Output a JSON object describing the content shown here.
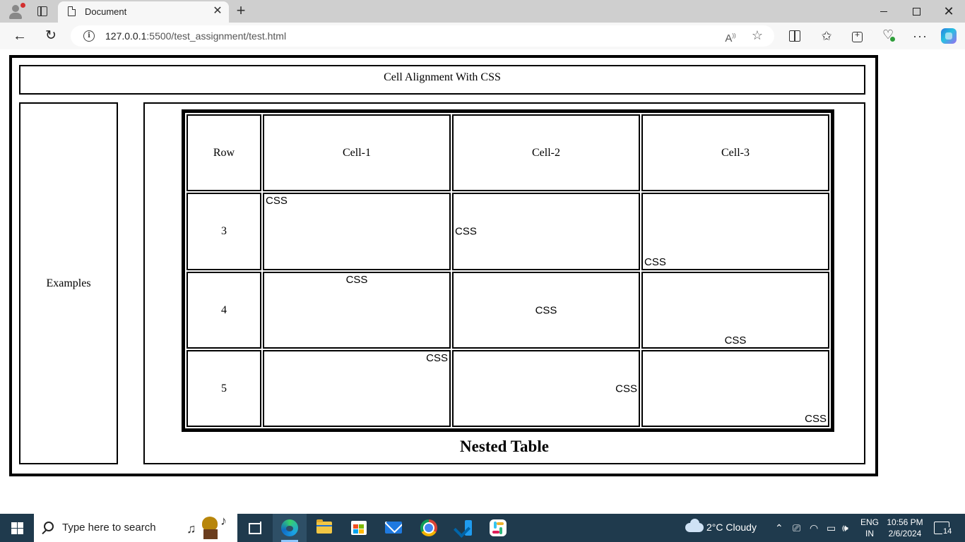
{
  "browser": {
    "tab_title": "Document",
    "url_host": "127.0.0.1",
    "url_rest": ":5500/test_assignment/test.html"
  },
  "page": {
    "header": "Cell Alignment With CSS",
    "side_label": "Examples",
    "nested_caption": "Nested Table",
    "nested_table": {
      "headers": [
        "Row",
        "Cell-1",
        "Cell-2",
        "Cell-3"
      ],
      "rows": [
        {
          "label": "3",
          "cells": [
            {
              "text": "CSS",
              "h_align": "left",
              "v_align": "top"
            },
            {
              "text": "CSS",
              "h_align": "left",
              "v_align": "middle"
            },
            {
              "text": "CSS",
              "h_align": "left",
              "v_align": "bottom"
            }
          ]
        },
        {
          "label": "4",
          "cells": [
            {
              "text": "CSS",
              "h_align": "center",
              "v_align": "top"
            },
            {
              "text": "CSS",
              "h_align": "center",
              "v_align": "middle"
            },
            {
              "text": "CSS",
              "h_align": "center",
              "v_align": "bottom"
            }
          ]
        },
        {
          "label": "5",
          "cells": [
            {
              "text": "CSS",
              "h_align": "right",
              "v_align": "top"
            },
            {
              "text": "CSS",
              "h_align": "right",
              "v_align": "middle"
            },
            {
              "text": "CSS",
              "h_align": "right",
              "v_align": "bottom"
            }
          ]
        }
      ]
    }
  },
  "taskbar": {
    "search_placeholder": "Type here to search",
    "weather": "2°C  Cloudy",
    "lang_line1": "ENG",
    "lang_line2": "IN",
    "time": "10:56 PM",
    "date": "2/6/2024",
    "notification_count": "14",
    "apps": [
      "task-view",
      "edge",
      "file-explorer",
      "microsoft-store",
      "mail",
      "chrome",
      "vscode",
      "slack"
    ]
  },
  "colors": {
    "tabbar_bg": "#cfcfcf",
    "addressbar_bg": "#f7f7f7",
    "taskbar_bg": "#1f3a4d",
    "border": "#000000"
  }
}
